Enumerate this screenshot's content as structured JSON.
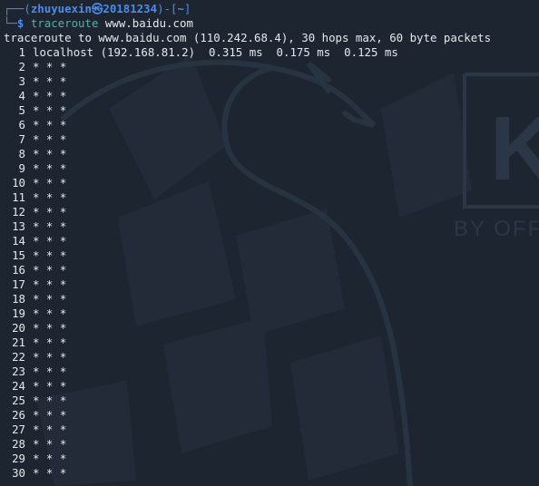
{
  "prompt": {
    "user": "zhuyuexin",
    "at_symbol": "㉿",
    "host": "20181234",
    "dir": "~",
    "command_name": "traceroute",
    "command_args": "www.baidu.com"
  },
  "output": {
    "header": "traceroute to www.baidu.com (110.242.68.4), 30 hops max, 60 byte packets",
    "hops": [
      {
        "num": "1",
        "text": "localhost (192.168.81.2)  0.315 ms  0.175 ms  0.125 ms"
      },
      {
        "num": "2",
        "text": "* * *"
      },
      {
        "num": "3",
        "text": "* * *"
      },
      {
        "num": "4",
        "text": "* * *"
      },
      {
        "num": "5",
        "text": "* * *"
      },
      {
        "num": "6",
        "text": "* * *"
      },
      {
        "num": "7",
        "text": "* * *"
      },
      {
        "num": "8",
        "text": "* * *"
      },
      {
        "num": "9",
        "text": "* * *"
      },
      {
        "num": "10",
        "text": "* * *"
      },
      {
        "num": "11",
        "text": "* * *"
      },
      {
        "num": "12",
        "text": "* * *"
      },
      {
        "num": "13",
        "text": "* * *"
      },
      {
        "num": "14",
        "text": "* * *"
      },
      {
        "num": "15",
        "text": "* * *"
      },
      {
        "num": "16",
        "text": "* * *"
      },
      {
        "num": "17",
        "text": "* * *"
      },
      {
        "num": "18",
        "text": "* * *"
      },
      {
        "num": "19",
        "text": "* * *"
      },
      {
        "num": "20",
        "text": "* * *"
      },
      {
        "num": "21",
        "text": "* * *"
      },
      {
        "num": "22",
        "text": "* * *"
      },
      {
        "num": "23",
        "text": "* * *"
      },
      {
        "num": "24",
        "text": "* * *"
      },
      {
        "num": "25",
        "text": "* * *"
      },
      {
        "num": "26",
        "text": "* * *"
      },
      {
        "num": "27",
        "text": "* * *"
      },
      {
        "num": "28",
        "text": "* * *"
      },
      {
        "num": "29",
        "text": "* * *"
      },
      {
        "num": "30",
        "text": "* * *"
      }
    ]
  },
  "wallpaper": {
    "logo_text": "BY OFF",
    "logo_letter": "K"
  },
  "colors": {
    "background": "#1d2530",
    "prompt_blue": "#4b8bf0",
    "prompt_green": "#3fb950",
    "text": "#e6e8ec"
  }
}
